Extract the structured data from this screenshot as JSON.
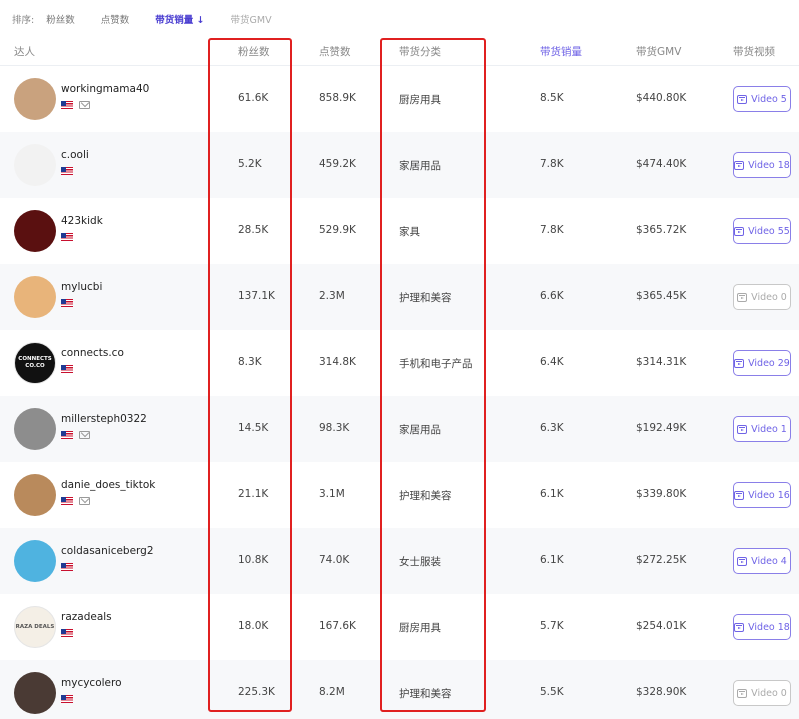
{
  "sort": {
    "label": "排序:",
    "options": [
      "粉丝数",
      "点赞数",
      "带货销量 ↓",
      "带货GMV"
    ]
  },
  "headers": {
    "creator": "达人",
    "followers": "粉丝数",
    "likes": "点赞数",
    "category": "带货分类",
    "sales": "带货销量",
    "gmv": "带货GMV",
    "videos": "带货视频"
  },
  "rows": [
    {
      "name": "workingmama40",
      "mail": true,
      "followers": "61.6K",
      "likes": "858.9K",
      "category": "厨房用具",
      "sales": "8.5K",
      "gmv": "$440.80K",
      "video": "Video 5",
      "video_enabled": true,
      "avatar_color": "#c9a27e"
    },
    {
      "name": "c.ooli",
      "mail": false,
      "followers": "5.2K",
      "likes": "459.2K",
      "category": "家居用品",
      "sales": "7.8K",
      "gmv": "$474.40K",
      "video": "Video 18",
      "video_enabled": true,
      "avatar_color": "#f2f2f2"
    },
    {
      "name": "423kidk",
      "mail": false,
      "followers": "28.5K",
      "likes": "529.9K",
      "category": "家具",
      "sales": "7.8K",
      "gmv": "$365.72K",
      "video": "Video 55",
      "video_enabled": true,
      "avatar_color": "#5a1010"
    },
    {
      "name": "mylucbi",
      "mail": false,
      "followers": "137.1K",
      "likes": "2.3M",
      "category": "护理和美容",
      "sales": "6.6K",
      "gmv": "$365.45K",
      "video": "Video 0",
      "video_enabled": false,
      "avatar_color": "#e8b47a"
    },
    {
      "name": "connects.co",
      "mail": false,
      "followers": "8.3K",
      "likes": "314.8K",
      "category": "手机和电子产品",
      "sales": "6.4K",
      "gmv": "$314.31K",
      "video": "Video 29",
      "video_enabled": true,
      "avatar_color": "#111111",
      "avatar_text": "CONNECTS CO.CO"
    },
    {
      "name": "millersteph0322",
      "mail": true,
      "followers": "14.5K",
      "likes": "98.3K",
      "category": "家居用品",
      "sales": "6.3K",
      "gmv": "$192.49K",
      "video": "Video 1",
      "video_enabled": true,
      "avatar_color": "#8d8d8d"
    },
    {
      "name": "danie_does_tiktok",
      "mail": true,
      "followers": "21.1K",
      "likes": "3.1M",
      "category": "护理和美容",
      "sales": "6.1K",
      "gmv": "$339.80K",
      "video": "Video 16",
      "video_enabled": true,
      "avatar_color": "#b98a5c"
    },
    {
      "name": "coldasaniceberg2",
      "mail": false,
      "followers": "10.8K",
      "likes": "74.0K",
      "category": "女士服装",
      "sales": "6.1K",
      "gmv": "$272.25K",
      "video": "Video 4",
      "video_enabled": true,
      "avatar_color": "#4fb3e0"
    },
    {
      "name": "razadeals",
      "mail": false,
      "followers": "18.0K",
      "likes": "167.6K",
      "category": "厨房用具",
      "sales": "5.7K",
      "gmv": "$254.01K",
      "video": "Video 18",
      "video_enabled": true,
      "avatar_color": "#f4efe6",
      "avatar_text": "RAZA DEALS"
    },
    {
      "name": "mycycolero",
      "mail": false,
      "followers": "225.3K",
      "likes": "8.2M",
      "category": "护理和美容",
      "sales": "5.5K",
      "gmv": "$328.90K",
      "video": "Video 0",
      "video_enabled": false,
      "avatar_color": "#4a3a34"
    }
  ]
}
